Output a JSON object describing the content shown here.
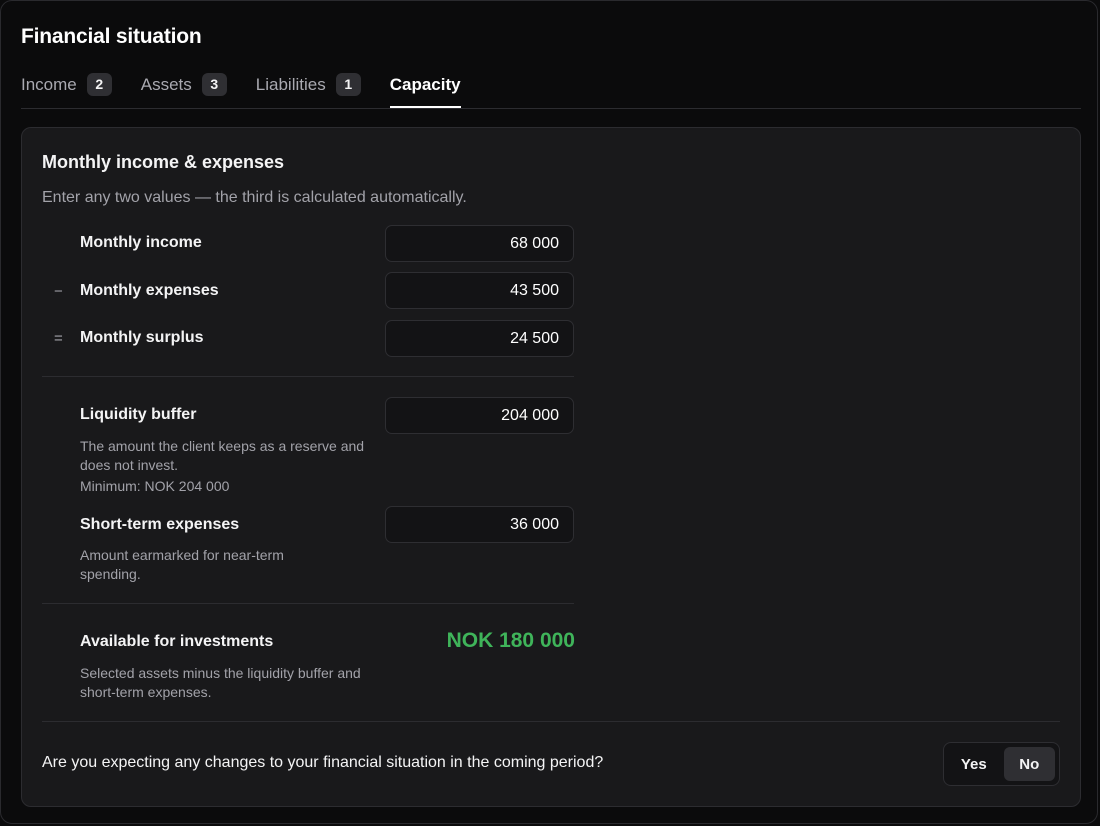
{
  "page": {
    "title": "Financial situation"
  },
  "tabs": [
    {
      "label": "Income",
      "badge": "2"
    },
    {
      "label": "Assets",
      "badge": "3"
    },
    {
      "label": "Liabilities",
      "badge": "1"
    },
    {
      "label": "Capacity",
      "active": true
    }
  ],
  "card": {
    "title": "Monthly income & expenses",
    "subtitle": "Enter any two values — the third is calculated automatically.",
    "rows": {
      "income": {
        "label": "Monthly income",
        "value": "68 000"
      },
      "expenses": {
        "operator": "−",
        "label": "Monthly expenses",
        "value": "43 500"
      },
      "surplus": {
        "operator": "=",
        "label": "Monthly surplus",
        "value": "24 500"
      }
    },
    "liquidity": {
      "label": "Liquidity buffer",
      "value": "204 000",
      "help": "The amount the client keeps as a reserve and does not invest.",
      "minimum": "Minimum: NOK 204 000"
    },
    "short_term": {
      "label": "Short-term expenses",
      "value": "36 000",
      "help": "Amount earmarked for near-term spending."
    },
    "available": {
      "label": "Available for investments",
      "value": "NOK 180 000",
      "help": "Selected assets minus the liquidity buffer and short-term expenses."
    },
    "question": {
      "text": "Are you expecting any changes to your financial situation in the coming period?",
      "options": [
        "Yes",
        "No"
      ],
      "selected": "No"
    }
  },
  "colors": {
    "accent_positive": "#3fb45a",
    "background": "#0b0b0c",
    "card_background": "#19191b"
  }
}
